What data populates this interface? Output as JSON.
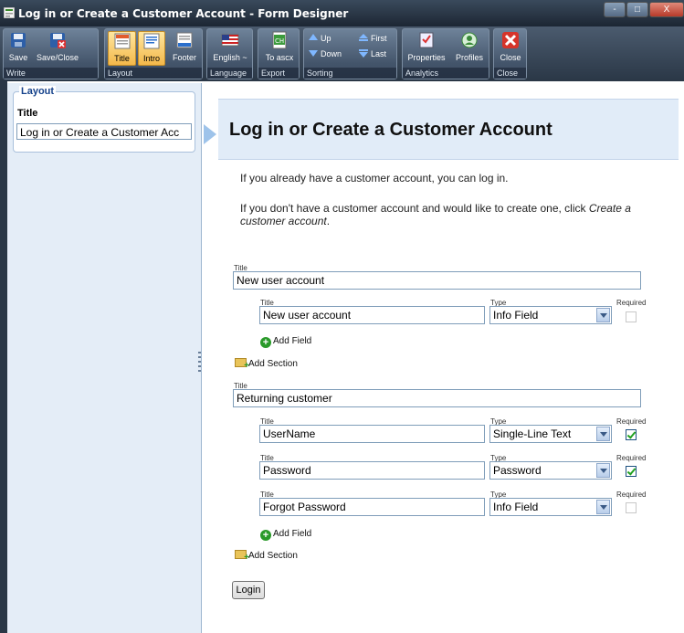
{
  "window": {
    "title": "Log in or Create a Customer Account - Form Designer",
    "controls": {
      "minimize": "-",
      "maximize": "□",
      "close": "X"
    }
  },
  "ribbon": {
    "groups": {
      "write": "Write",
      "layout": "Layout",
      "language": "Language",
      "export": "Export",
      "sorting": "Sorting",
      "analytics": "Analytics",
      "close": "Close"
    },
    "buttons": {
      "save": "Save",
      "save_close": "Save/Close",
      "title": "Title",
      "intro": "Intro",
      "footer": "Footer",
      "language": "English ~",
      "to_ascx": "To ascx",
      "up": "Up",
      "down": "Down",
      "first": "First",
      "last": "Last",
      "properties": "Properties",
      "profiles": "Profiles",
      "close": "Close"
    }
  },
  "left_pane": {
    "legend": "Layout",
    "title_label": "Title",
    "title_value": "Log in or Create a Customer Acc"
  },
  "form": {
    "title": "Log in or Create a Customer Account",
    "intro_1": "If you already have a customer account, you can log in.",
    "intro_2a": "If you don't have a customer account and would like to create one, click ",
    "intro_2b": "Create a",
    "intro_2c": "customer account",
    "intro_2d": ".",
    "labels": {
      "title": "Title",
      "type": "Type",
      "required": "Required"
    },
    "add_field": "Add Field",
    "add_section": "Add Section",
    "sections": [
      {
        "title": "New user account",
        "fields": [
          {
            "title": "New user account",
            "type": "Info Field",
            "required": false
          }
        ]
      },
      {
        "title": "Returning customer",
        "fields": [
          {
            "title": "UserName",
            "type": "Single-Line Text",
            "required": true
          },
          {
            "title": "Password",
            "type": "Password",
            "required": true
          },
          {
            "title": "Forgot Password",
            "type": "Info Field",
            "required": false
          }
        ]
      }
    ],
    "login_button": "Login"
  }
}
